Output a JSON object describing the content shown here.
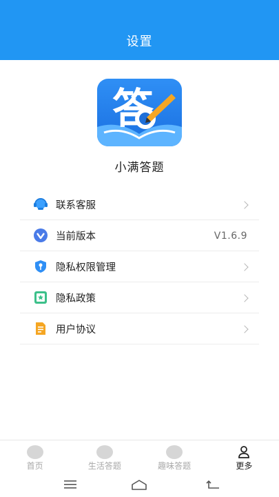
{
  "header": {
    "title": "设置"
  },
  "app": {
    "name": "小满答题",
    "logo_char": "答",
    "logo_icon": "pen-answer-logo"
  },
  "menu": [
    {
      "label": "联系客服",
      "icon": "customer-service-icon",
      "color": "#3aa0ff",
      "has_chevron": true
    },
    {
      "label": "当前版本",
      "icon": "version-icon",
      "color": "#4a7be8",
      "value": "V1.6.9"
    },
    {
      "label": "隐私权限管理",
      "icon": "shield-key-icon",
      "color": "#2f8ff5",
      "has_chevron": true
    },
    {
      "label": "隐私政策",
      "icon": "bookmark-star-icon",
      "color": "#3cc08a",
      "has_chevron": true
    },
    {
      "label": "用户协议",
      "icon": "document-icon",
      "color": "#f5a623",
      "has_chevron": true
    }
  ],
  "tabs": [
    {
      "label": "首页",
      "active": false
    },
    {
      "label": "生活答题",
      "active": false
    },
    {
      "label": "趣味答题",
      "active": false
    },
    {
      "label": "更多",
      "active": true
    }
  ],
  "system_nav": [
    "menu-icon",
    "home-icon",
    "back-icon"
  ],
  "colors": {
    "header": "#2196f3",
    "divider": "#ececec"
  }
}
